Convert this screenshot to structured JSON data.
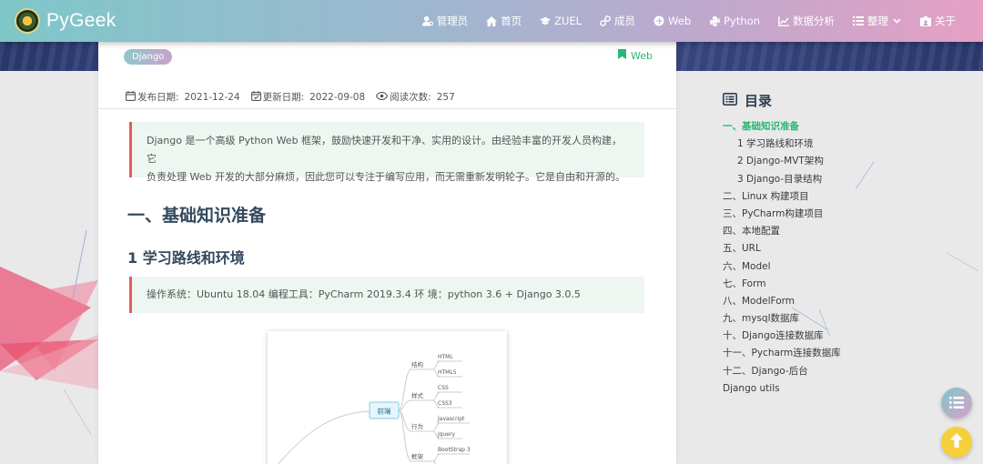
{
  "brand": {
    "name": "PyGeek"
  },
  "nav": {
    "items": [
      {
        "label": "管理员",
        "icon": "user-gear-icon"
      },
      {
        "label": "首页",
        "icon": "home-icon"
      },
      {
        "label": "ZUEL",
        "icon": "graduation-cap-icon"
      },
      {
        "label": "成员",
        "icon": "link-icon"
      },
      {
        "label": "Web",
        "icon": "web-icon"
      },
      {
        "label": "Python",
        "icon": "python-icon"
      },
      {
        "label": "数据分析",
        "icon": "chart-icon"
      },
      {
        "label": "整理",
        "icon": "list-icon"
      },
      {
        "label": "关于",
        "icon": "id-card-icon"
      }
    ]
  },
  "article": {
    "tag": "Django",
    "category": "Web",
    "meta": {
      "published_label": "发布日期:",
      "published": "2021-12-24",
      "updated_label": "更新日期:",
      "updated": "2022-09-08",
      "views_label": "阅读次数:",
      "views": "257"
    },
    "intro_line1": "Django 是一个高级 Python Web 框架，鼓励快速开发和干净、实用的设计。由经验丰富的开发人员构建，它",
    "intro_line2": "负责处理 Web 开发的大部分麻烦，因此您可以专注于编写应用，而无需重新发明轮子。它是自由和开源的。",
    "heading1": "一、基础知识准备",
    "heading2": "1 学习路线和环境",
    "env_note": "操作系统：Ubuntu 18.04 编程工具：PyCharm 2019.3.4 环 境：python 3.6 + Django 3.0.5",
    "mindmap": {
      "root": "前端",
      "branches": [
        "结构",
        "样式",
        "行为",
        "框架"
      ],
      "leaves": [
        "HTML",
        "HTML5",
        "CSS",
        "CSS3",
        "Javascript",
        "Jquery",
        "BootStrap 3"
      ]
    }
  },
  "toc": {
    "title": "目录",
    "items": [
      {
        "label": "一、基础知识准备",
        "level": 1,
        "active": true
      },
      {
        "label": "1 学习路线和环境",
        "level": 2
      },
      {
        "label": "2 Django-MVT架构",
        "level": 2
      },
      {
        "label": "3 Django-目录结构",
        "level": 2
      },
      {
        "label": "二、Linux 构建项目",
        "level": 1
      },
      {
        "label": "三、PyCharm构建项目",
        "level": 1
      },
      {
        "label": "四、本地配置",
        "level": 1
      },
      {
        "label": "五、URL",
        "level": 1
      },
      {
        "label": "六、Model",
        "level": 1
      },
      {
        "label": "七、Form",
        "level": 1
      },
      {
        "label": "八、ModelForm",
        "level": 1
      },
      {
        "label": "九、mysql数据库",
        "level": 1
      },
      {
        "label": "十、Django连接数据库",
        "level": 1
      },
      {
        "label": "十一、Pycharm连接数据库",
        "level": 1
      },
      {
        "label": "十二、Django-后台",
        "level": 1
      },
      {
        "label": "Django utils",
        "level": 1
      }
    ]
  },
  "colors": {
    "accent_green": "#2bb673",
    "quote_border": "#e35d5b",
    "heading": "#34495e"
  }
}
